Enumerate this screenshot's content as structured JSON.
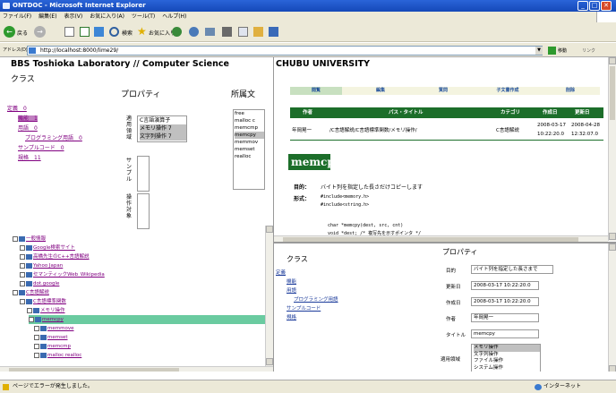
{
  "window": {
    "title": "ONTDOC - Microsoft Internet Explorer"
  },
  "menu": [
    "ファイル(F)",
    "編集(E)",
    "表示(V)",
    "お気に入り(A)",
    "ツール(T)",
    "ヘルプ(H)"
  ],
  "toolbar": {
    "back_label": "戻る",
    "search_label": "検索",
    "favorites_label": "お気に入り"
  },
  "address": {
    "label": "アドレス(D)",
    "url": "http://localhost:8000/lime29/",
    "go_label": "移動",
    "links_label": "リンク"
  },
  "header": {
    "left_title": "BBS Toshioka Laboratory // Computer Science",
    "right_title": "CHUBU UNIVERSITY"
  },
  "class_panel": {
    "heading": "クラス",
    "items": [
      "定義　0",
      "機能　1",
      "用語　0",
      "プログラミング用語　0",
      "サンプルコード　0",
      "規格　11"
    ]
  },
  "property_panel": {
    "heading": "プロパティ",
    "label_apply": "適用領域",
    "label_sample": "サンプル",
    "label_operation": "操作対象",
    "apply_options": [
      "C言語演算子",
      "メモリ操作 7",
      "文字列操作 7"
    ]
  },
  "related_panel": {
    "heading": "所属文",
    "items": [
      "free",
      "malloc c",
      "memcmp",
      "memcpy",
      "memmov",
      "memset",
      "realloc"
    ]
  },
  "tree": [
    {
      "label": "一般情報",
      "indent": 0
    },
    {
      "label": "Google検索サイト",
      "indent": 1
    },
    {
      "label": "高橋先生のC++言語解説",
      "indent": 1
    },
    {
      "label": "Yahoo Japan",
      "indent": 1
    },
    {
      "label": "セマンティックWeb_Wikipedia",
      "indent": 1
    },
    {
      "label": "dot.google",
      "indent": 1
    },
    {
      "label": "C言語解説",
      "indent": 0
    },
    {
      "label": "C言語標準関数",
      "indent": 1
    },
    {
      "label": "メモリ操作",
      "indent": 2
    },
    {
      "label": "memcpy",
      "indent": 3,
      "selected": true
    },
    {
      "label": "memmove",
      "indent": 3
    },
    {
      "label": "memset",
      "indent": 3
    },
    {
      "label": "memcmp",
      "indent": 3
    },
    {
      "label": "malloc realloc",
      "indent": 3
    }
  ],
  "tabs": [
    "閲覧",
    "編集",
    "質問",
    "子文書作成",
    "削除"
  ],
  "doc_table": {
    "headers": [
      "作者",
      "パス・タイトル",
      "カテゴリ",
      "作成日",
      "更新日"
    ],
    "row": [
      "年岡晃一",
      "/C言語解説/C言語標準関数/メモリ操作/",
      "C言語解説",
      "2008-03-17 10:22:20.0",
      "2008-04-28 12:32:07.0"
    ]
  },
  "doc": {
    "title": "memcpy",
    "purpose_label": "目的：",
    "purpose": "バイト列を指定した長さだけコピーします",
    "form_label": "形式：",
    "include1": "#include<memory.h>",
    "include2": "#include<string.h>",
    "code1": "char *memcpy(dest, src, cnt)",
    "code2": "void *dest; /* 複写先を示すポインタ */"
  },
  "lower_class": {
    "heading": "クラス",
    "items": [
      "定義",
      "機能",
      "用語",
      "プログラミング用語",
      "サンプルコード",
      "規格"
    ]
  },
  "lower_property": {
    "heading": "プロパティ",
    "fields": [
      {
        "label": "目的",
        "value": "バイト列を指定した長さまで"
      },
      {
        "label": "更新日",
        "value": "2008-03-17 10:22:20.0"
      },
      {
        "label": "作成日",
        "value": "2008-03-17 10:22:20.0"
      },
      {
        "label": "作者",
        "value": "年岡晃一"
      },
      {
        "label": "タイトル",
        "value": "memcpy"
      }
    ],
    "apply_label": "適用領域",
    "apply_options": [
      "メモリ操作",
      "文字列操作",
      "ファイル操作",
      "システム操作"
    ]
  },
  "status": {
    "text": "ページでエラーが発生しました。",
    "zone": "インターネット"
  }
}
